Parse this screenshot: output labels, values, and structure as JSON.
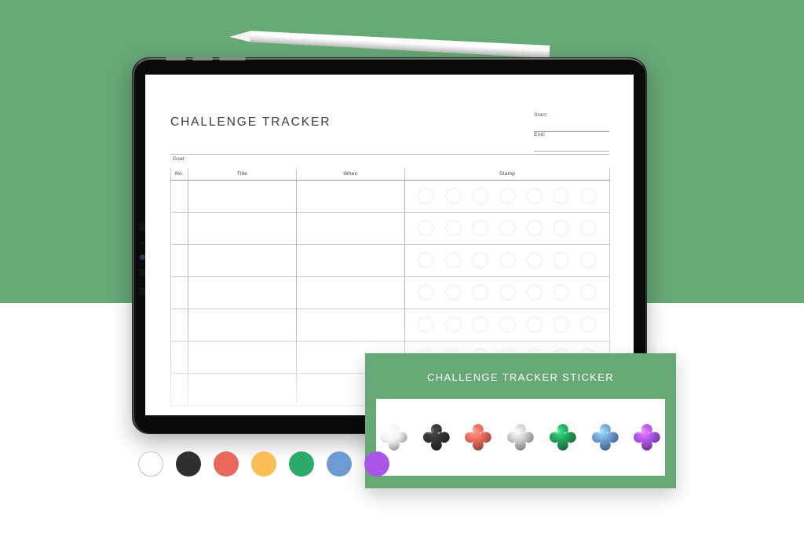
{
  "background": {
    "top_color": "#66a876",
    "bottom_color": "#ffffff"
  },
  "device": {
    "name": "tablet",
    "body_color": "#0a0a0a",
    "stylus": "stylus-pen"
  },
  "worksheet": {
    "title": "CHALLENGE TRACKER",
    "meta": [
      {
        "label": "Start:",
        "value": ""
      },
      {
        "label": "End:",
        "value": ""
      }
    ],
    "goal_label": "Goal:",
    "goal_value": "",
    "table": {
      "columns": [
        "No.",
        "Title",
        "When",
        "Stamp"
      ],
      "row_count": 7,
      "stamps_per_row": 7,
      "stamp_shape": "quatrefoil-outline",
      "rows": [
        {
          "no": "",
          "title": "",
          "when": ""
        },
        {
          "no": "",
          "title": "",
          "when": ""
        },
        {
          "no": "",
          "title": "",
          "when": ""
        },
        {
          "no": "",
          "title": "",
          "when": ""
        },
        {
          "no": "",
          "title": "",
          "when": ""
        },
        {
          "no": "",
          "title": "",
          "when": ""
        },
        {
          "no": "",
          "title": "",
          "when": ""
        }
      ]
    }
  },
  "sticker_panel": {
    "title": "CHALLENGE TRACKER STICKER",
    "panel_color": "#66a876",
    "well_color": "#ffffff",
    "stickers": [
      {
        "name": "sticker-white",
        "color": "#f2f2f2"
      },
      {
        "name": "sticker-black",
        "color": "#333333"
      },
      {
        "name": "sticker-red",
        "color": "#e8695c"
      },
      {
        "name": "sticker-yellow",
        "color": "#f6c councils"
      },
      {
        "name": "sticker-green",
        "color": "#22a05c"
      },
      {
        "name": "sticker-blue",
        "color": "#6b9bd2"
      },
      {
        "name": "sticker-purple",
        "color": "#a855e8"
      }
    ]
  },
  "palette": {
    "swatches": [
      {
        "name": "swatch-white",
        "color": "#ffffff",
        "outlined": true
      },
      {
        "name": "swatch-black",
        "color": "#2f2f2f",
        "outlined": false
      },
      {
        "name": "swatch-red",
        "color": "#e8695c",
        "outlined": false
      },
      {
        "name": "swatch-yellow",
        "color": "#fbbd54",
        "outlined": false
      },
      {
        "name": "swatch-green",
        "color": "#2aab67",
        "outlined": false
      },
      {
        "name": "swatch-blue",
        "color": "#6b9bd2",
        "outlined": false
      },
      {
        "name": "swatch-purple",
        "color": "#a855e8",
        "outlined": false
      }
    ]
  }
}
